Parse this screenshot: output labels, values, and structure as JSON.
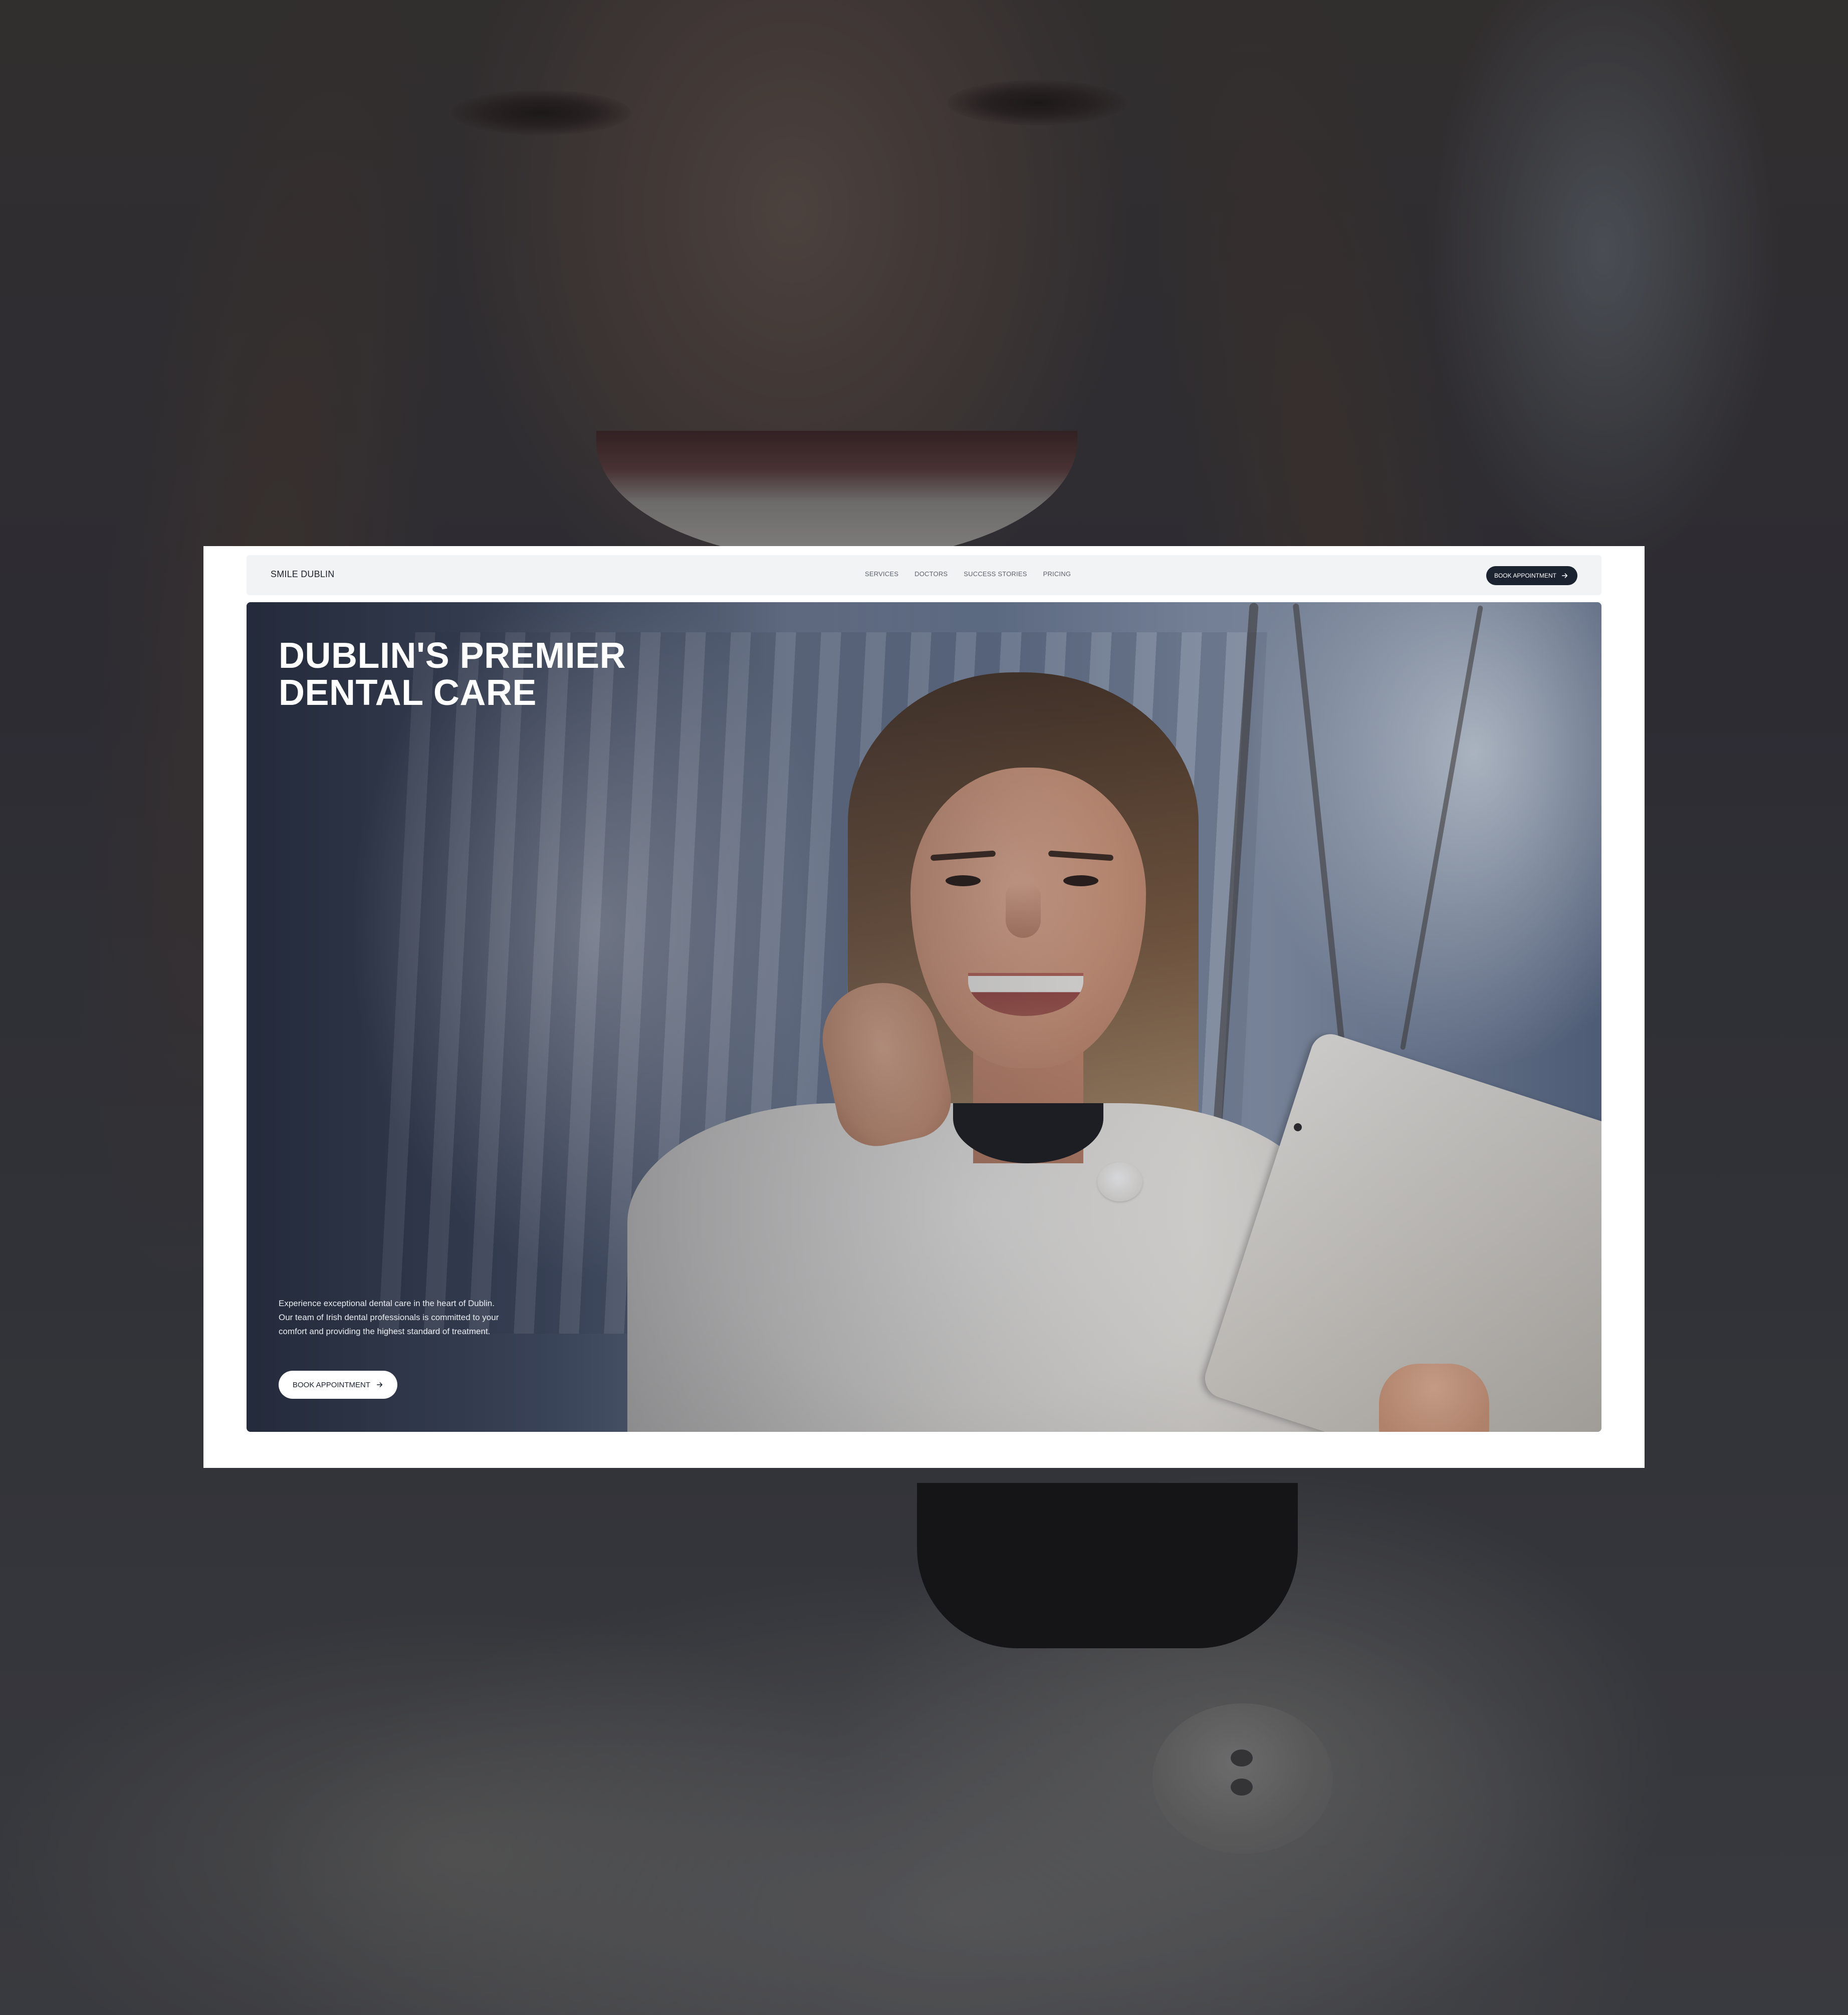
{
  "site": {
    "brand": "SMILE DUBLIN"
  },
  "nav": {
    "links": [
      {
        "label": "SERVICES"
      },
      {
        "label": "DOCTORS"
      },
      {
        "label": "SUCCESS STORIES"
      },
      {
        "label": "PRICING"
      }
    ],
    "cta_label": "BOOK APPOINTMENT",
    "cta_icon": "arrow-right-icon"
  },
  "hero": {
    "title_line1": "DUBLIN'S PREMIER",
    "title_line2": "DENTAL CARE",
    "description": "Experience exceptional dental care in the heart of Dublin. Our team of Irish dental professionals is committed to your comfort and providing the highest standard of treatment.",
    "cta_label": "BOOK APPOINTMENT",
    "cta_icon": "arrow-right-icon",
    "image": "smiling-woman-on-phone-with-tablet"
  },
  "colors": {
    "accent_dark": "#1b2230",
    "navbar_bg": "#f2f3f5",
    "card_bg": "#ffffff"
  }
}
